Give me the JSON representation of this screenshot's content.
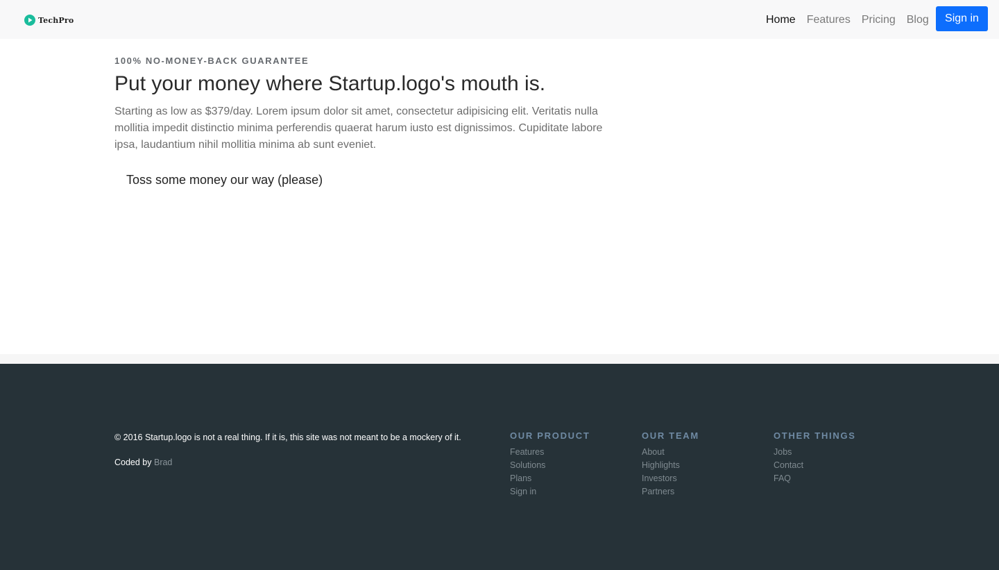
{
  "navbar": {
    "brand": {
      "icon": "play-circle-icon",
      "text": "TechPro",
      "icon_color": "#1abc9c"
    },
    "links": [
      {
        "label": "Home",
        "active": true
      },
      {
        "label": "Features",
        "active": false
      },
      {
        "label": "Pricing",
        "active": false
      },
      {
        "label": "Blog",
        "active": false
      }
    ],
    "signin_label": "Sign in",
    "signin_color": "#0d6efd"
  },
  "hero": {
    "eyebrow": "100% NO-MONEY-BACK GUARANTEE",
    "headline": "Put your money where Startup.logo's mouth is.",
    "lead": "Starting as low as $379/day. Lorem ipsum dolor sit amet, consectetur adipisicing elit. Veritatis nulla mollitia impedit distinctio minima perferendis quaerat harum iusto est dignissimos. Cupiditate labore ipsa, laudantium nihil mollitia minima ab sunt eveniet.",
    "cta_label": "Toss some money our way (please)"
  },
  "footer": {
    "background": "#263238",
    "copyright": "© 2016 Startup.logo is not a real thing. If it is, this site was not meant to be a mockery of it.",
    "coded_by_prefix": "Coded by ",
    "coded_by_name": "Brad",
    "columns": [
      {
        "heading": "OUR PRODUCT",
        "links": [
          "Features",
          "Solutions",
          "Plans",
          "Sign in"
        ]
      },
      {
        "heading": "OUR TEAM",
        "links": [
          "About",
          "Highlights",
          "Investors",
          "Partners"
        ]
      },
      {
        "heading": "OTHER THINGS",
        "links": [
          "Jobs",
          "Contact",
          "FAQ"
        ]
      }
    ]
  }
}
